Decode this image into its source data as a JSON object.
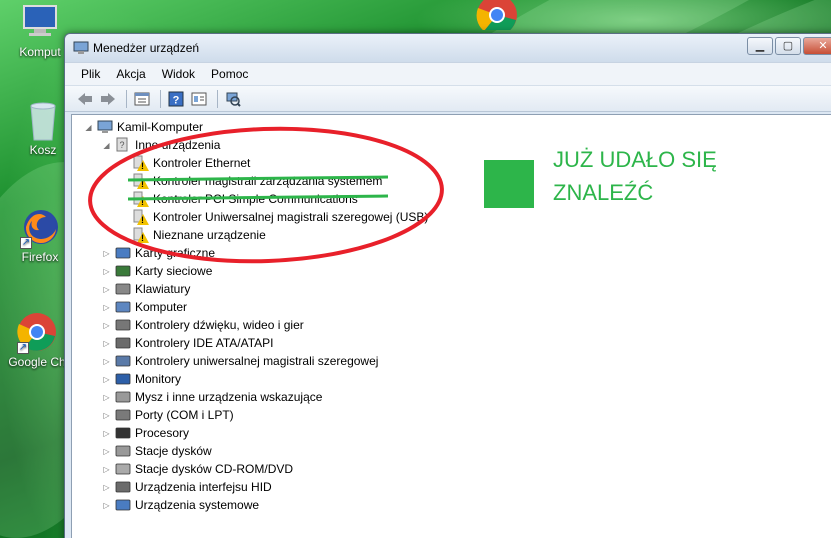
{
  "desktop": {
    "icons": [
      {
        "label": "Komput",
        "icon": "computer-icon"
      },
      {
        "label": "Kosz",
        "icon": "recycle-bin-icon"
      },
      {
        "label": "Firefox",
        "icon": "firefox-icon"
      },
      {
        "label": "Google Ch",
        "icon": "chrome-icon"
      }
    ]
  },
  "window": {
    "title": "Menedżer urządzeń",
    "menu": [
      "Plik",
      "Akcja",
      "Widok",
      "Pomoc"
    ],
    "toolbar_icons": [
      "back-arrow-icon",
      "forward-arrow-icon",
      "properties-icon",
      "help-icon",
      "view-icon",
      "scan-hardware-icon"
    ]
  },
  "tree": {
    "root": "Kamil-Komputer",
    "other_devices": {
      "label": "Inne urządzenia",
      "children": [
        "Kontroler Ethernet",
        "Kontroler magistrali zarządzania systemem",
        "Kontroler PCI Simple Communications",
        "Kontroler Uniwersalnej magistrali szeregowej (USB)",
        "Nieznane urządzenie"
      ]
    },
    "categories": [
      "Karty graficzne",
      "Karty sieciowe",
      "Klawiatury",
      "Komputer",
      "Kontrolery dźwięku, wideo i gier",
      "Kontrolery IDE ATA/ATAPI",
      "Kontrolery uniwersalnej magistrali szeregowej",
      "Monitory",
      "Mysz i inne urządzenia wskazujące",
      "Porty (COM i LPT)",
      "Procesory",
      "Stacje dysków",
      "Stacje dysków CD-ROM/DVD",
      "Urządzenia interfejsu HID",
      "Urządzenia systemowe"
    ]
  },
  "annotation": {
    "note_line1": "JUŻ UDAŁO SIĘ",
    "note_line2": "ZNALEŹĆ",
    "color": "#2db54a",
    "circle_color": "#e8202a"
  }
}
